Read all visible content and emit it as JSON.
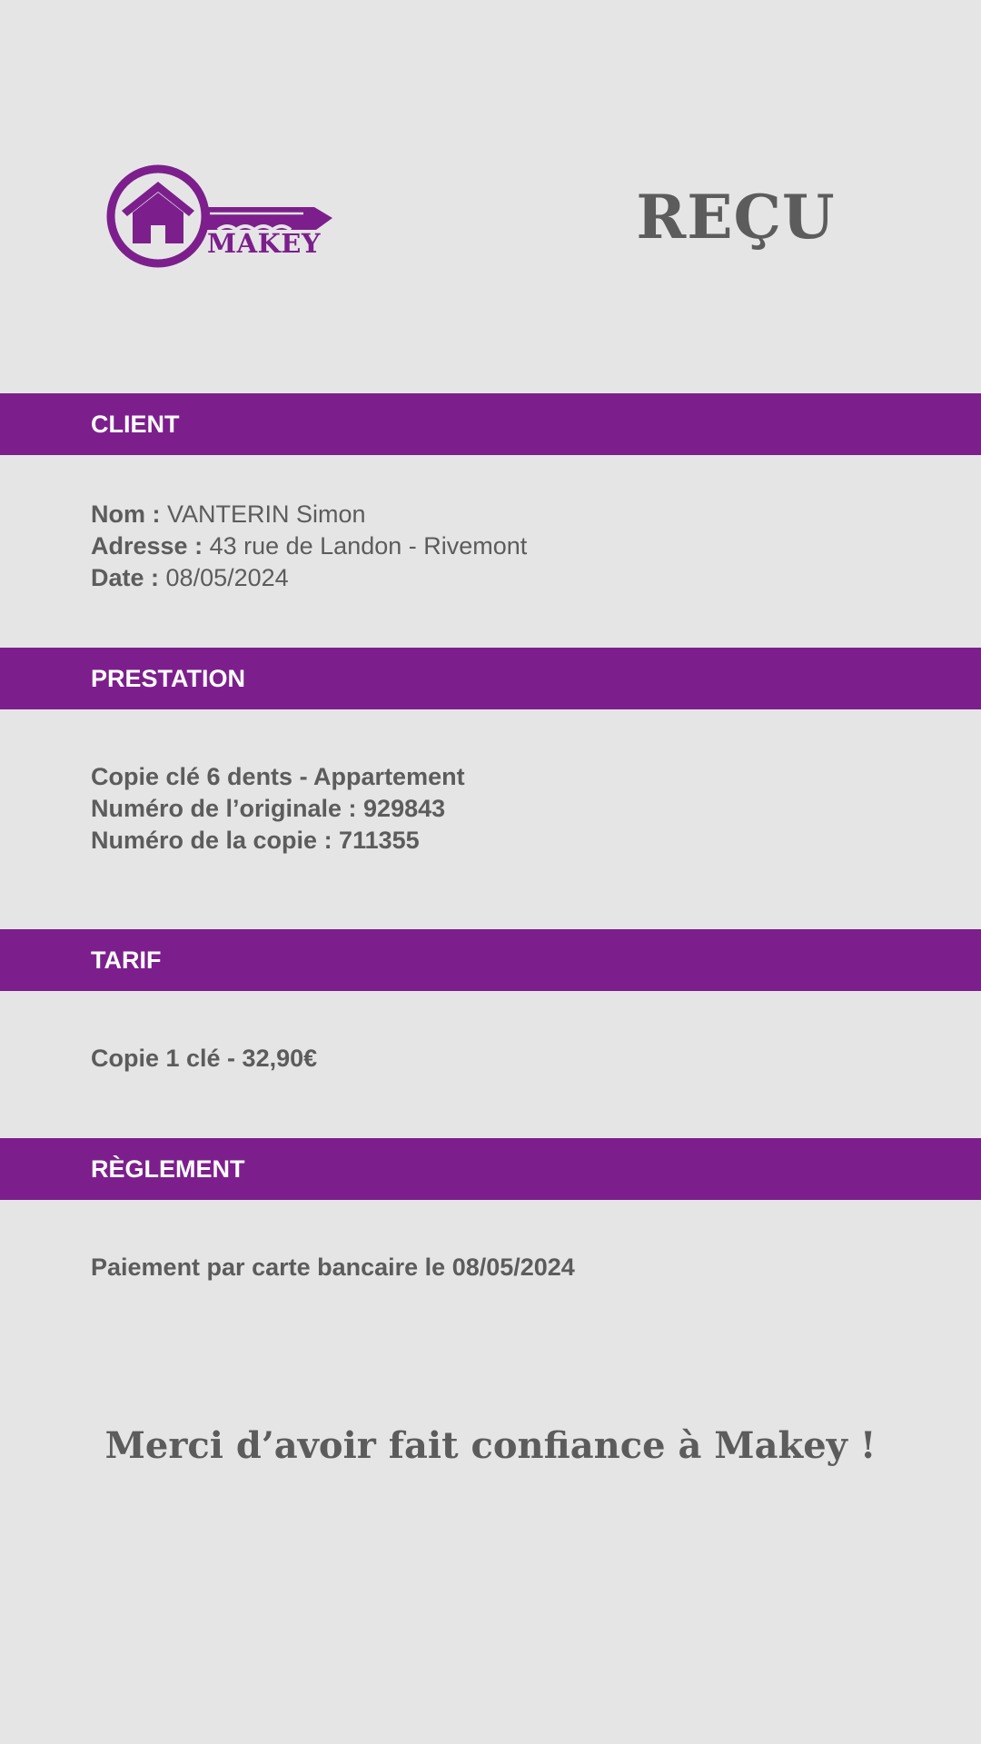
{
  "logo": {
    "brand": "MAKEY",
    "color": "#7c1f8c"
  },
  "header": {
    "title": "REÇU"
  },
  "sections": {
    "client": {
      "heading": "CLIENT",
      "name_label": "Nom :",
      "name_value": "VANTERIN Simon",
      "address_label": "Adresse :",
      "address_value": "43 rue de Landon - Rivemont",
      "date_label": "Date :",
      "date_value": "08/05/2024"
    },
    "prestation": {
      "heading": "PRESTATION",
      "lines": [
        "Copie clé 6 dents - Appartement",
        "Numéro de l’originale : 929843",
        "Numéro de la copie : 711355"
      ]
    },
    "tarif": {
      "heading": "TARIF",
      "line": "Copie 1 clé - 32,90€"
    },
    "reglement": {
      "heading": "RÈGLEMENT",
      "line": "Paiement par carte bancaire le 08/05/2024"
    }
  },
  "footer": {
    "thanks": "Merci d’avoir fait confiance à Makey !"
  },
  "colors": {
    "accent": "#7c1f8c",
    "background": "#e5e5e6",
    "text": "#5c5c5c"
  }
}
